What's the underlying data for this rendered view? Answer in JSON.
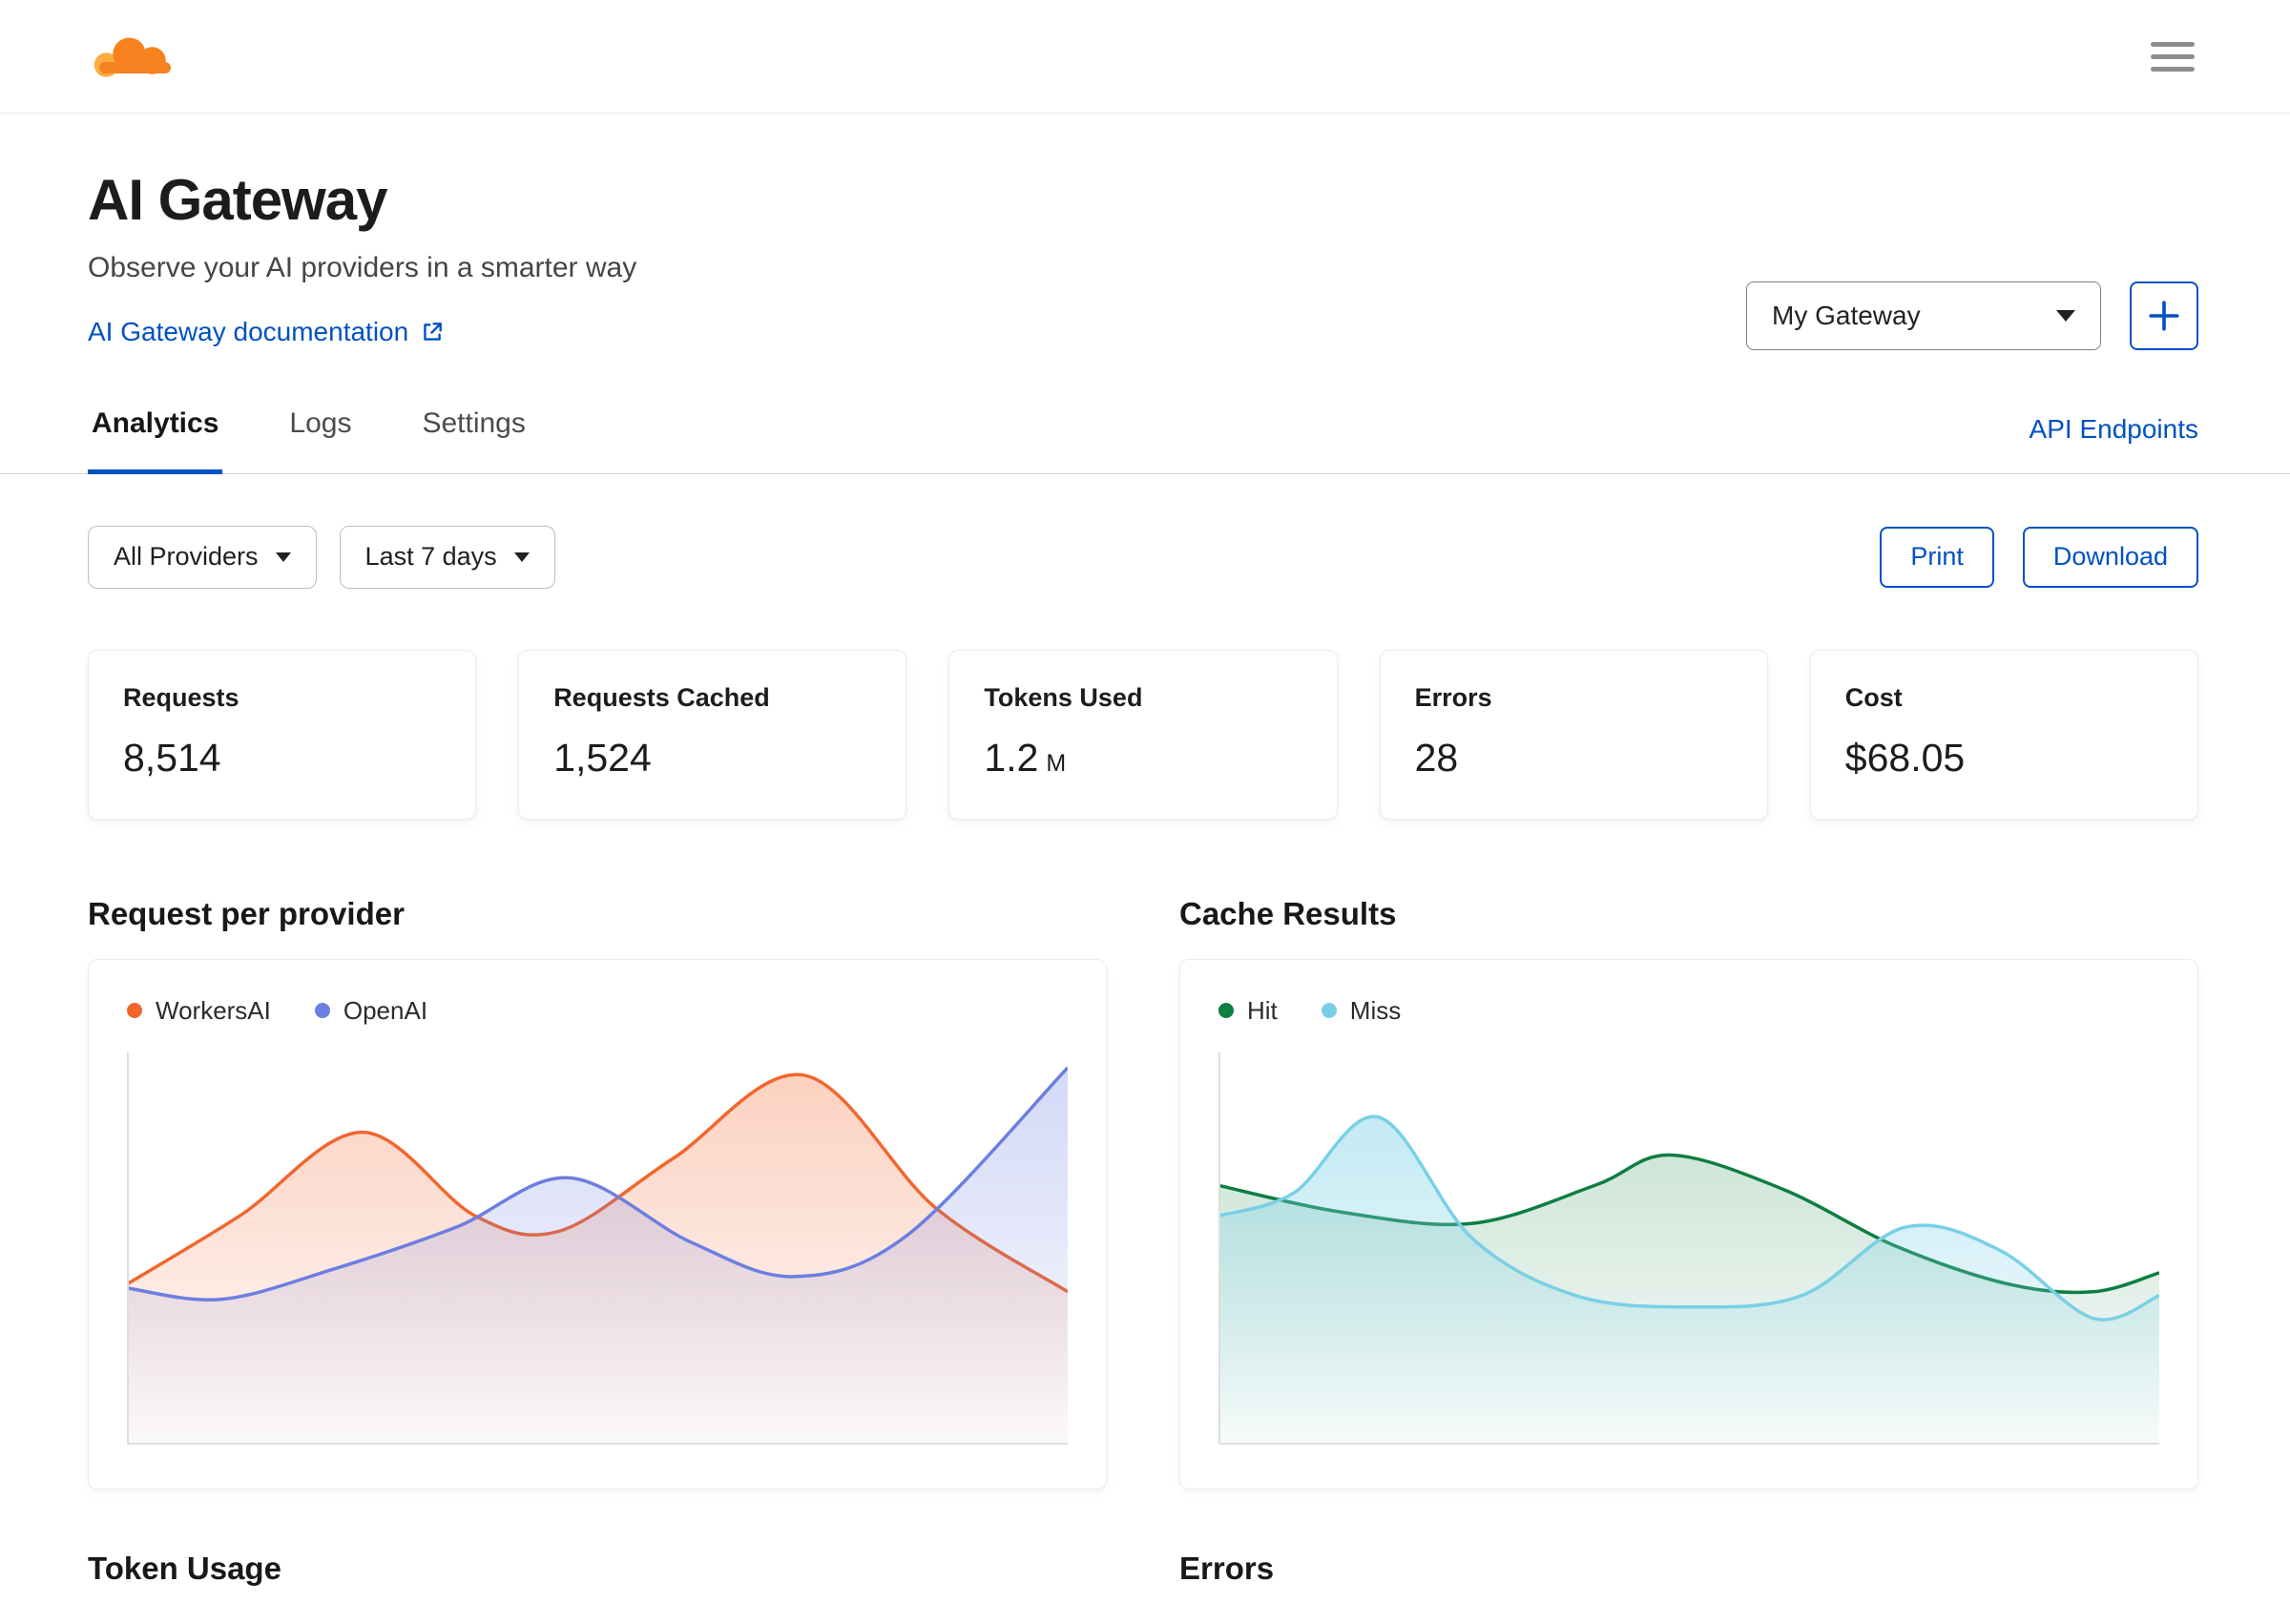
{
  "topbar": {
    "logo_name": "cloudflare-logo",
    "menu_icon": "hamburger-icon"
  },
  "header": {
    "title": "AI Gateway",
    "subtitle": "Observe your AI providers in a smarter way",
    "doc_link_label": "AI Gateway documentation",
    "gateway_selected": "My Gateway",
    "add_gateway_label": "+"
  },
  "tabs": {
    "items": [
      {
        "label": "Analytics",
        "active": true
      },
      {
        "label": "Logs",
        "active": false
      },
      {
        "label": "Settings",
        "active": false
      }
    ],
    "right_link": "API Endpoints"
  },
  "filters": {
    "provider_selected": "All Providers",
    "range_selected": "Last 7 days",
    "print_label": "Print",
    "download_label": "Download"
  },
  "stats": [
    {
      "label": "Requests",
      "value": "8,514"
    },
    {
      "label": "Requests Cached",
      "value": "1,524"
    },
    {
      "label": "Tokens Used",
      "value": "1.2",
      "unit": "M"
    },
    {
      "label": "Errors",
      "value": "28"
    },
    {
      "label": "Cost",
      "value": "$68.05"
    }
  ],
  "chart_data": [
    {
      "type": "area",
      "title": "Request per provider",
      "legend_position": "top-left",
      "grid": false,
      "x_range": [
        0,
        1
      ],
      "y_range": [
        0,
        1
      ],
      "series": [
        {
          "name": "WorkersAI",
          "color": "#f2662d",
          "fill_opacity": 0.3,
          "points": [
            [
              0,
              0.42
            ],
            [
              0.12,
              0.6
            ],
            [
              0.25,
              0.82
            ],
            [
              0.37,
              0.6
            ],
            [
              0.46,
              0.56
            ],
            [
              0.58,
              0.75
            ],
            [
              0.72,
              0.97
            ],
            [
              0.86,
              0.62
            ],
            [
              1,
              0.4
            ]
          ]
        },
        {
          "name": "OpenAI",
          "color": "#6c7ee1",
          "fill_opacity": 0.3,
          "points": [
            [
              0,
              0.41
            ],
            [
              0.1,
              0.38
            ],
            [
              0.22,
              0.46
            ],
            [
              0.35,
              0.57
            ],
            [
              0.47,
              0.7
            ],
            [
              0.6,
              0.53
            ],
            [
              0.71,
              0.44
            ],
            [
              0.83,
              0.55
            ],
            [
              1,
              0.99
            ]
          ]
        }
      ]
    },
    {
      "type": "area",
      "title": "Cache Results",
      "legend_position": "top-left",
      "grid": false,
      "x_range": [
        0,
        1
      ],
      "y_range": [
        0,
        1
      ],
      "series": [
        {
          "name": "Hit",
          "color": "#0e7e41",
          "fill_opacity": 0.2,
          "points": [
            [
              0,
              0.68
            ],
            [
              0.13,
              0.61
            ],
            [
              0.27,
              0.58
            ],
            [
              0.4,
              0.68
            ],
            [
              0.48,
              0.76
            ],
            [
              0.6,
              0.67
            ],
            [
              0.72,
              0.52
            ],
            [
              0.84,
              0.42
            ],
            [
              0.93,
              0.4
            ],
            [
              1,
              0.45
            ]
          ]
        },
        {
          "name": "Miss",
          "color": "#79d0e6",
          "fill_opacity": 0.45,
          "points": [
            [
              0,
              0.6
            ],
            [
              0.08,
              0.66
            ],
            [
              0.17,
              0.86
            ],
            [
              0.27,
              0.54
            ],
            [
              0.38,
              0.39
            ],
            [
              0.5,
              0.36
            ],
            [
              0.62,
              0.39
            ],
            [
              0.73,
              0.57
            ],
            [
              0.83,
              0.51
            ],
            [
              0.93,
              0.33
            ],
            [
              1,
              0.39
            ]
          ]
        }
      ]
    }
  ],
  "bottom_sections": [
    {
      "title": "Token Usage"
    },
    {
      "title": "Errors"
    }
  ],
  "icons": {
    "hamburger": "three horizontal bars",
    "external_link": "box with outgoing arrow",
    "caret_down": "▾",
    "plus": "+"
  },
  "colors": {
    "accent_blue": "#0051c3",
    "brand_orange": "#f6821f",
    "brand_orange_light": "#fbad41",
    "border_gray": "#d6d6d6"
  }
}
